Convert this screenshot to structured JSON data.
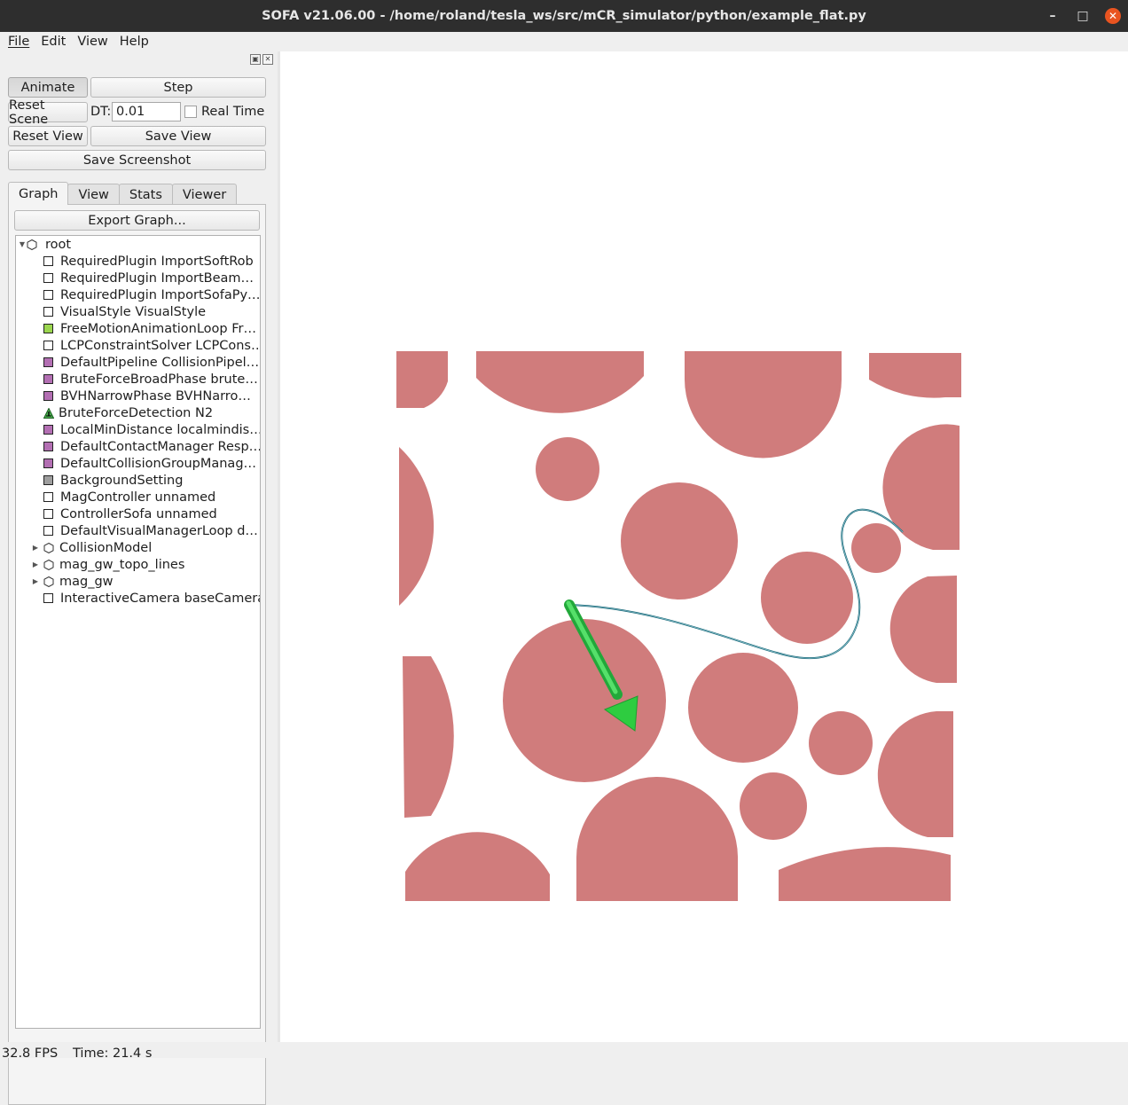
{
  "window": {
    "title": "SOFA v21.06.00 - /home/roland/tesla_ws/src/mCR_simulator/python/example_flat.py",
    "minimize": "–",
    "maximize": "□",
    "close": "✕"
  },
  "menu": {
    "file": "File",
    "edit": "Edit",
    "view": "View",
    "help": "Help"
  },
  "controls": {
    "animate": "Animate",
    "step": "Step",
    "reset_scene": "Reset Scene",
    "dt_label": "DT:",
    "dt_value": "0.01",
    "real_time_label": "Real Time",
    "real_time_checked": false,
    "reset_view": "Reset View",
    "save_view": "Save View",
    "save_screenshot": "Save Screenshot"
  },
  "tabs": [
    "Graph",
    "View",
    "Stats",
    "Viewer"
  ],
  "graph": {
    "export_label": "Export Graph...",
    "root": "root",
    "nodes": [
      {
        "label": "RequiredPlugin ImportSoftRob",
        "kind": "component",
        "color": "#ffffff"
      },
      {
        "label": "RequiredPlugin ImportBeam…",
        "kind": "component",
        "color": "#ffffff"
      },
      {
        "label": "RequiredPlugin ImportSofaPy…",
        "kind": "component",
        "color": "#ffffff"
      },
      {
        "label": "VisualStyle VisualStyle",
        "kind": "component",
        "color": "#ffffff"
      },
      {
        "label": "FreeMotionAnimationLoop Fr…",
        "kind": "component",
        "color": "#9bd64f"
      },
      {
        "label": "LCPConstraintSolver LCPCons…",
        "kind": "component",
        "color": "#ffffff"
      },
      {
        "label": "DefaultPipeline CollisionPipel…",
        "kind": "component",
        "color": "#b36fb3"
      },
      {
        "label": "BruteForceBroadPhase brute…",
        "kind": "component",
        "color": "#b36fb3"
      },
      {
        "label": "BVHNarrowPhase BVHNarro…",
        "kind": "component",
        "color": "#b36fb3"
      },
      {
        "label": "BruteForceDetection N2",
        "kind": "warning",
        "color": "#4caf50"
      },
      {
        "label": "LocalMinDistance localmindis…",
        "kind": "component",
        "color": "#b36fb3"
      },
      {
        "label": "DefaultContactManager Resp…",
        "kind": "component",
        "color": "#b36fb3"
      },
      {
        "label": "DefaultCollisionGroupManag…",
        "kind": "component",
        "color": "#b36fb3"
      },
      {
        "label": "BackgroundSetting",
        "kind": "component",
        "color": "#9e9e9e"
      },
      {
        "label": "MagController unnamed",
        "kind": "component",
        "color": "#ffffff"
      },
      {
        "label": "ControllerSofa unnamed",
        "kind": "component",
        "color": "#ffffff"
      },
      {
        "label": "DefaultVisualManagerLoop d…",
        "kind": "component",
        "color": "#ffffff"
      },
      {
        "label": "CollisionModel",
        "kind": "node",
        "color": "#ffffff"
      },
      {
        "label": "mag_gw_topo_lines",
        "kind": "node",
        "color": "#ffffff"
      },
      {
        "label": "mag_gw",
        "kind": "node",
        "color": "#ffffff"
      },
      {
        "label": "InteractiveCamera baseCamera",
        "kind": "component",
        "color": "#ffffff"
      }
    ]
  },
  "scene": {
    "obstacle_color": "#d07c7c",
    "guidewire_color": "#1c6a7a",
    "field_arrow_color": "#2ecc40"
  },
  "status": {
    "fps": "32.8 FPS",
    "time": "Time: 21.4 s"
  }
}
